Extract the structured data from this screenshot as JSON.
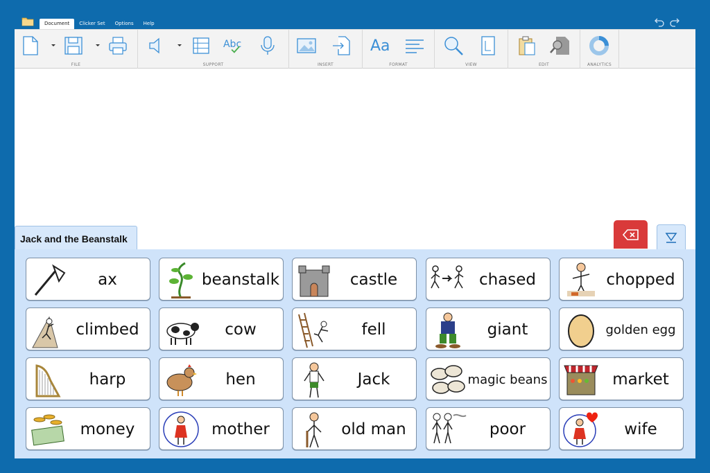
{
  "menu": {
    "tabs": [
      "Document",
      "Clicker Set",
      "Options",
      "Help"
    ]
  },
  "ribbon": {
    "groups": [
      {
        "label": "FILE",
        "buttons": [
          "new-document",
          "save",
          "print"
        ]
      },
      {
        "label": "SUPPORT",
        "buttons": [
          "speech",
          "word-predictor",
          "spell-check",
          "voice-input"
        ]
      },
      {
        "label": "INSERT",
        "buttons": [
          "insert-picture",
          "insert-file"
        ]
      },
      {
        "label": "FORMAT",
        "buttons": [
          "font",
          "paragraph"
        ]
      },
      {
        "label": "VIEW",
        "buttons": [
          "zoom",
          "page-view"
        ]
      },
      {
        "label": "EDIT",
        "buttons": [
          "paste",
          "find"
        ]
      },
      {
        "label": "ANALYTICS",
        "buttons": [
          "analytics"
        ]
      }
    ]
  },
  "clicker_set": {
    "title": "Jack and the Beanstalk",
    "cells": [
      {
        "word": "ax",
        "icon": "ax-icon"
      },
      {
        "word": "beanstalk",
        "icon": "beanstalk-icon"
      },
      {
        "word": "castle",
        "icon": "castle-icon"
      },
      {
        "word": "chased",
        "icon": "chased-icon"
      },
      {
        "word": "chopped",
        "icon": "chopped-icon"
      },
      {
        "word": "climbed",
        "icon": "climbed-icon"
      },
      {
        "word": "cow",
        "icon": "cow-icon"
      },
      {
        "word": "fell",
        "icon": "fell-icon"
      },
      {
        "word": "giant",
        "icon": "giant-icon"
      },
      {
        "word": "golden egg",
        "icon": "golden-egg-icon"
      },
      {
        "word": "harp",
        "icon": "harp-icon"
      },
      {
        "word": "hen",
        "icon": "hen-icon"
      },
      {
        "word": "Jack",
        "icon": "jack-icon"
      },
      {
        "word": "magic beans",
        "icon": "magic-beans-icon"
      },
      {
        "word": "market",
        "icon": "market-icon"
      },
      {
        "word": "money",
        "icon": "money-icon"
      },
      {
        "word": "mother",
        "icon": "mother-icon"
      },
      {
        "word": "old man",
        "icon": "old-man-icon"
      },
      {
        "word": "poor",
        "icon": "poor-icon"
      },
      {
        "word": "wife",
        "icon": "wife-icon"
      }
    ]
  },
  "colors": {
    "background": "#0e6bad",
    "panel": "#cfe3fa",
    "delete": "#d93a3a",
    "ribbon_icon": "#3b8fd6"
  }
}
